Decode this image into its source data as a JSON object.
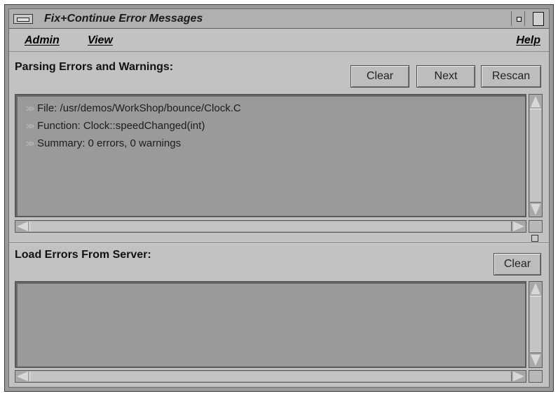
{
  "window": {
    "title": "Fix+Continue Error Messages"
  },
  "menubar": {
    "admin": "Admin",
    "view": "View",
    "help": "Help"
  },
  "parsing": {
    "label": "Parsing Errors and Warnings:",
    "buttons": {
      "clear": "Clear",
      "next": "Next",
      "rescan": "Rescan"
    },
    "lines": [
      {
        "marker": ">>",
        "text": "File: /usr/demos/WorkShop/bounce/Clock.C"
      },
      {
        "marker": ">>",
        "text": "Function: Clock::speedChanged(int)"
      },
      {
        "marker": ">>",
        "text": "Summary: 0 errors, 0 warnings"
      }
    ]
  },
  "server": {
    "label": "Load Errors From Server:",
    "buttons": {
      "clear": "Clear"
    }
  },
  "colors": {
    "window_bg": "#c2c2c2",
    "pane_bg": "#9a9a9a",
    "title_bg": "#b0b0b0"
  }
}
